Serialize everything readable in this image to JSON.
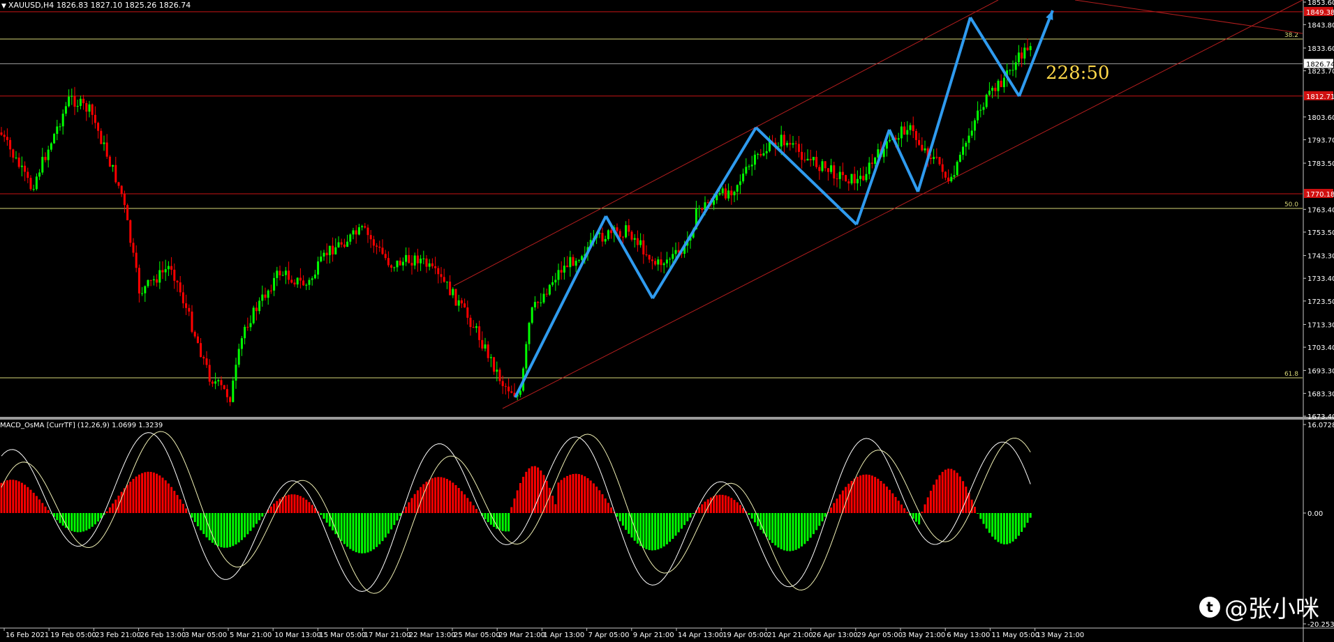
{
  "header": {
    "symbol": "XAUUSD,H4",
    "ohlc": "1826.83 1827.10 1825.26 1826.74"
  },
  "oscillator": {
    "title": "MACD_OsMA [CurrTF] (12,26,9) 1.0699 1.3239"
  },
  "price_axis": {
    "labels": [
      "1853.60",
      "1843.80",
      "1833.60",
      "1823.70",
      "1803.60",
      "1793.70",
      "1783.50",
      "1763.40",
      "1753.50",
      "1743.30",
      "1733.40",
      "1723.50",
      "1713.30",
      "1703.40",
      "1693.30",
      "1683.30",
      "1673.40"
    ],
    "current_price": "1826.74",
    "red_level_labels": [
      "1849.38",
      "1812.71",
      "1770.18"
    ]
  },
  "osc_axis": {
    "labels": [
      "16.0728",
      "0.00",
      "-20.2531"
    ]
  },
  "fib_labels": [
    "38.2",
    "50.0",
    "61.8"
  ],
  "time_axis": {
    "labels": [
      "16 Feb 2021",
      "19 Feb 05:00",
      "23 Feb 21:00",
      "26 Feb 13:00",
      "3 Mar 05:00",
      "5 Mar 21:00",
      "10 Mar 13:00",
      "15 Mar 05:00",
      "17 Mar 21:00",
      "22 Mar 13:00",
      "25 Mar 05:00",
      "29 Mar 21:00",
      "1 Apr 13:00",
      "7 Apr 05:00",
      "9 Apr 21:00",
      "14 Apr 13:00",
      "19 Apr 05:00",
      "21 Apr 21:00",
      "26 Apr 13:00",
      "29 Apr 05:00",
      "3 May 21:00",
      "6 May 13:00",
      "11 May 05:00",
      "13 May 21:00"
    ]
  },
  "annotation": {
    "ratio": "228:50"
  },
  "watermark": {
    "text": "@张小咪",
    "logo": "toutiao-logo"
  },
  "colors": {
    "background": "#000000",
    "bull_candle": "#00ff00",
    "bear_candle": "#ff0000",
    "level_red": "#c81414",
    "fib_yellow": "#d8d878",
    "channel_red": "#b41e1e",
    "zigzag_blue": "#2f9bef",
    "macd_pos": "#ff0000",
    "macd_neg": "#00ff00",
    "signal_line": "#f0f0b4"
  }
}
